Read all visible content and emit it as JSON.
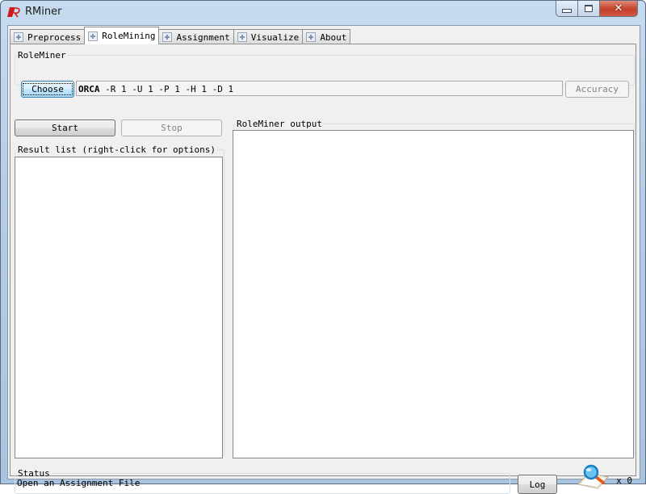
{
  "window": {
    "title": "RMiner",
    "controls": {
      "minimize": "minimize",
      "maximize": "maximize",
      "close": "close"
    }
  },
  "tabs": [
    {
      "label": "Preprocess",
      "active": false
    },
    {
      "label": "RoleMining",
      "active": true
    },
    {
      "label": "Assignment",
      "active": false
    },
    {
      "label": "Visualize",
      "active": false
    },
    {
      "label": "About",
      "active": false
    }
  ],
  "roleminer": {
    "group_label": "RoleMiner",
    "choose_label": "Choose",
    "algorithm": "ORCA",
    "options": " -R 1 -U 1 -P 1 -H 1 -D 1",
    "accuracy_label": "Accuracy"
  },
  "controls": {
    "start_label": "Start",
    "stop_label": "Stop"
  },
  "result_list": {
    "label": "Result list (right-click for options)",
    "items": []
  },
  "output": {
    "label": "RoleMiner output",
    "text": ""
  },
  "status": {
    "label": "Status",
    "message": "Open an Assignment File",
    "log_label": "Log",
    "task_count": "x 0"
  }
}
